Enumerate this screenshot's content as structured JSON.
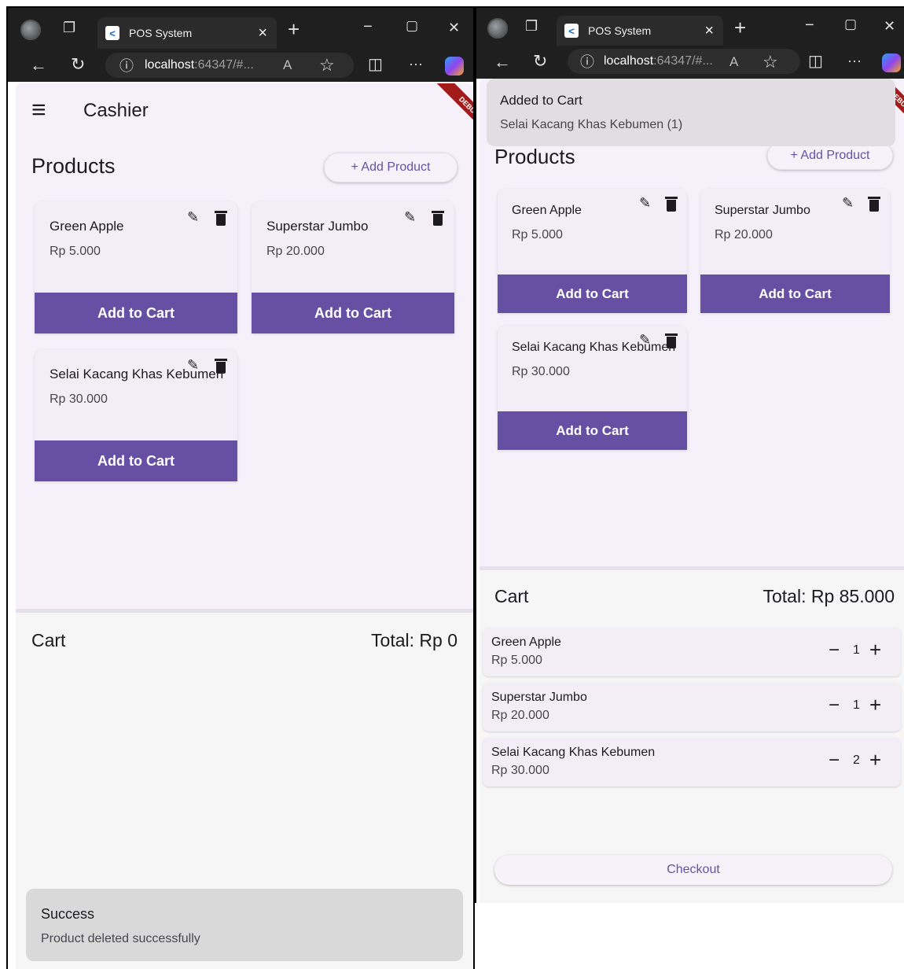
{
  "browser": {
    "tab_title": "POS System",
    "favicon_glyph": "<",
    "new_tab": "+",
    "url_host": "localhost",
    "url_rest": ":64347/#...",
    "minimize": "−",
    "maximize": "▢",
    "close": "✕",
    "back": "←",
    "reload": "↻",
    "info": "ⓘ",
    "read_aloud": "A",
    "favorite": "☆",
    "split": "◫",
    "more": "···",
    "tab_close": "×"
  },
  "left": {
    "appbar": {
      "menu_icon": "≡",
      "title": "Cashier"
    },
    "debug_banner": "DEBUG",
    "products_heading": "Products",
    "add_product": "+  Add Product",
    "products": [
      {
        "name": "Green Apple",
        "price": "Rp 5.000",
        "action": "Add to Cart"
      },
      {
        "name": "Superstar Jumbo",
        "price": "Rp 20.000",
        "action": "Add to Cart"
      },
      {
        "name": "Selai Kacang Khas Kebumen",
        "price": "Rp 30.000",
        "action": "Add to Cart"
      }
    ],
    "cart": {
      "title": "Cart",
      "total": "Total: Rp 0"
    },
    "snackbar": {
      "title": "Success",
      "message": "Product deleted successfully"
    }
  },
  "right": {
    "debug_banner": "DEBUG",
    "snackbar": {
      "title": "Added to Cart",
      "message": "Selai Kacang Khas Kebumen (1)"
    },
    "products_heading": "Products",
    "add_product": "+  Add Product",
    "products": [
      {
        "name": "Green Apple",
        "price": "Rp 5.000",
        "action": "Add to Cart"
      },
      {
        "name": "Superstar Jumbo",
        "price": "Rp 20.000",
        "action": "Add to Cart"
      },
      {
        "name": "Selai Kacang Khas Kebumen",
        "price": "Rp 30.000",
        "action": "Add to Cart"
      }
    ],
    "cart": {
      "title": "Cart",
      "total": "Total: Rp 85.000",
      "items": [
        {
          "name": "Green Apple",
          "price": "Rp 5.000",
          "qty": "1"
        },
        {
          "name": "Superstar Jumbo",
          "price": "Rp 20.000",
          "qty": "1"
        },
        {
          "name": "Selai Kacang Khas Kebumen",
          "price": "Rp 30.000",
          "qty": "2"
        }
      ],
      "minus": "−",
      "plus": "+",
      "checkout": "Checkout"
    }
  },
  "colors": {
    "primary": "#6750a4",
    "surface": "#f6f0fb",
    "card": "#f3edf7",
    "chrome": "#1f1f1f"
  }
}
